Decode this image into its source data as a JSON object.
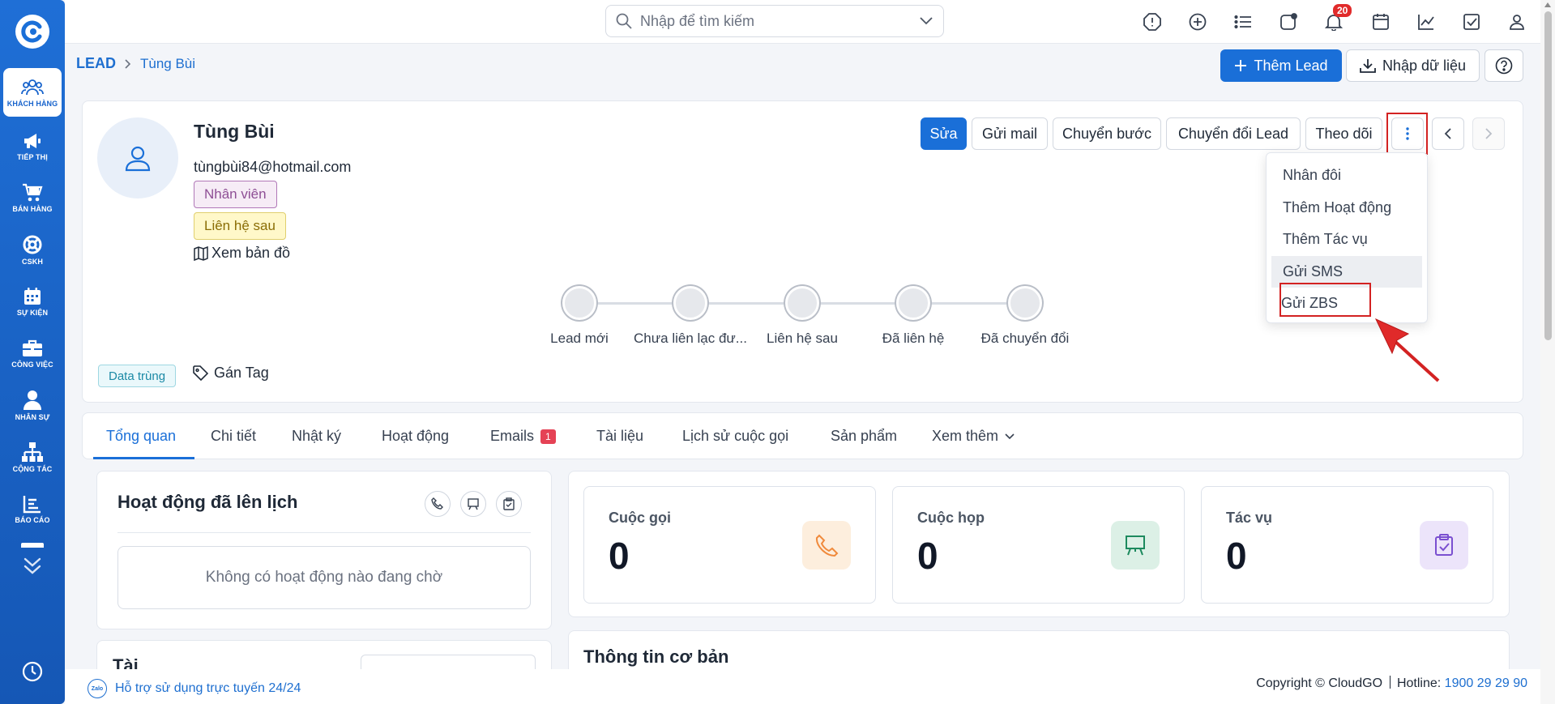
{
  "search": {
    "placeholder": "Nhập để tìm kiếm"
  },
  "notifications": {
    "count": "20"
  },
  "sidebar": {
    "items": [
      {
        "label": "KHÁCH HÀNG",
        "icon": "users-icon"
      },
      {
        "label": "TIẾP THỊ",
        "icon": "megaphone-icon"
      },
      {
        "label": "BÁN HÀNG",
        "icon": "cart-icon"
      },
      {
        "label": "CSKH",
        "icon": "lifebuoy-icon"
      },
      {
        "label": "SỰ KIỆN",
        "icon": "calendar-icon"
      },
      {
        "label": "CÔNG VIỆC",
        "icon": "briefcase-icon"
      },
      {
        "label": "NHÂN SỰ",
        "icon": "person-icon"
      },
      {
        "label": "CỘNG TÁC",
        "icon": "org-chart-icon"
      },
      {
        "label": "BÁO CÁO",
        "icon": "report-icon"
      }
    ]
  },
  "breadcrumb": {
    "root": "LEAD",
    "current": "Tùng Bùi"
  },
  "header_actions": {
    "add_lead": "Thêm Lead",
    "import": "Nhập dữ liệu"
  },
  "profile": {
    "name": "Tùng Bùi",
    "email": "tùngbùi84@hotmail.com",
    "tag_role": "Nhân viên",
    "tag_status": "Liên hệ sau",
    "map": "Xem bản đồ",
    "duplicate": "Data trùng",
    "assign_tag": "Gán Tag"
  },
  "actions": {
    "edit": "Sửa",
    "send_mail": "Gửi mail",
    "move_step": "Chuyển bước",
    "convert": "Chuyển đổi Lead",
    "follow": "Theo dõi"
  },
  "dropdown": {
    "items": [
      "Nhân đôi",
      "Thêm Hoạt động",
      "Thêm Tác vụ",
      "Gửi SMS",
      "Gửi ZBS"
    ]
  },
  "stages": [
    "Lead mới",
    "Chưa liên lạc đư...",
    "Liên hệ sau",
    "Đã liên hệ",
    "Đã chuyển đổi"
  ],
  "tabs": [
    {
      "label": "Tổng quan"
    },
    {
      "label": "Chi tiết"
    },
    {
      "label": "Nhật ký"
    },
    {
      "label": "Hoạt động"
    },
    {
      "label": "Emails",
      "badge": "1"
    },
    {
      "label": "Tài liệu"
    },
    {
      "label": "Lịch sử cuộc gọi"
    },
    {
      "label": "Sản phẩm"
    },
    {
      "label": "Xem thêm"
    }
  ],
  "activity": {
    "title": "Hoạt động đã lên lịch",
    "empty": "Không có hoạt động nào đang chờ",
    "next_section": "Tài liệu"
  },
  "stats": [
    {
      "title": "Cuộc gọi",
      "value": "0",
      "color": "#f08a3c"
    },
    {
      "title": "Cuộc họp",
      "value": "0",
      "color": "#1d8a5e"
    },
    {
      "title": "Tác vụ",
      "value": "0",
      "color": "#7a4fd0"
    }
  ],
  "basic_info": {
    "title": "Thông tin cơ bản"
  },
  "footer": {
    "support": "Hỗ trợ sử dụng trực tuyến 24/24",
    "copyright": "Copyright © CloudGO",
    "hotline_label": "Hotline:",
    "hotline": "1900 29 29 90"
  }
}
